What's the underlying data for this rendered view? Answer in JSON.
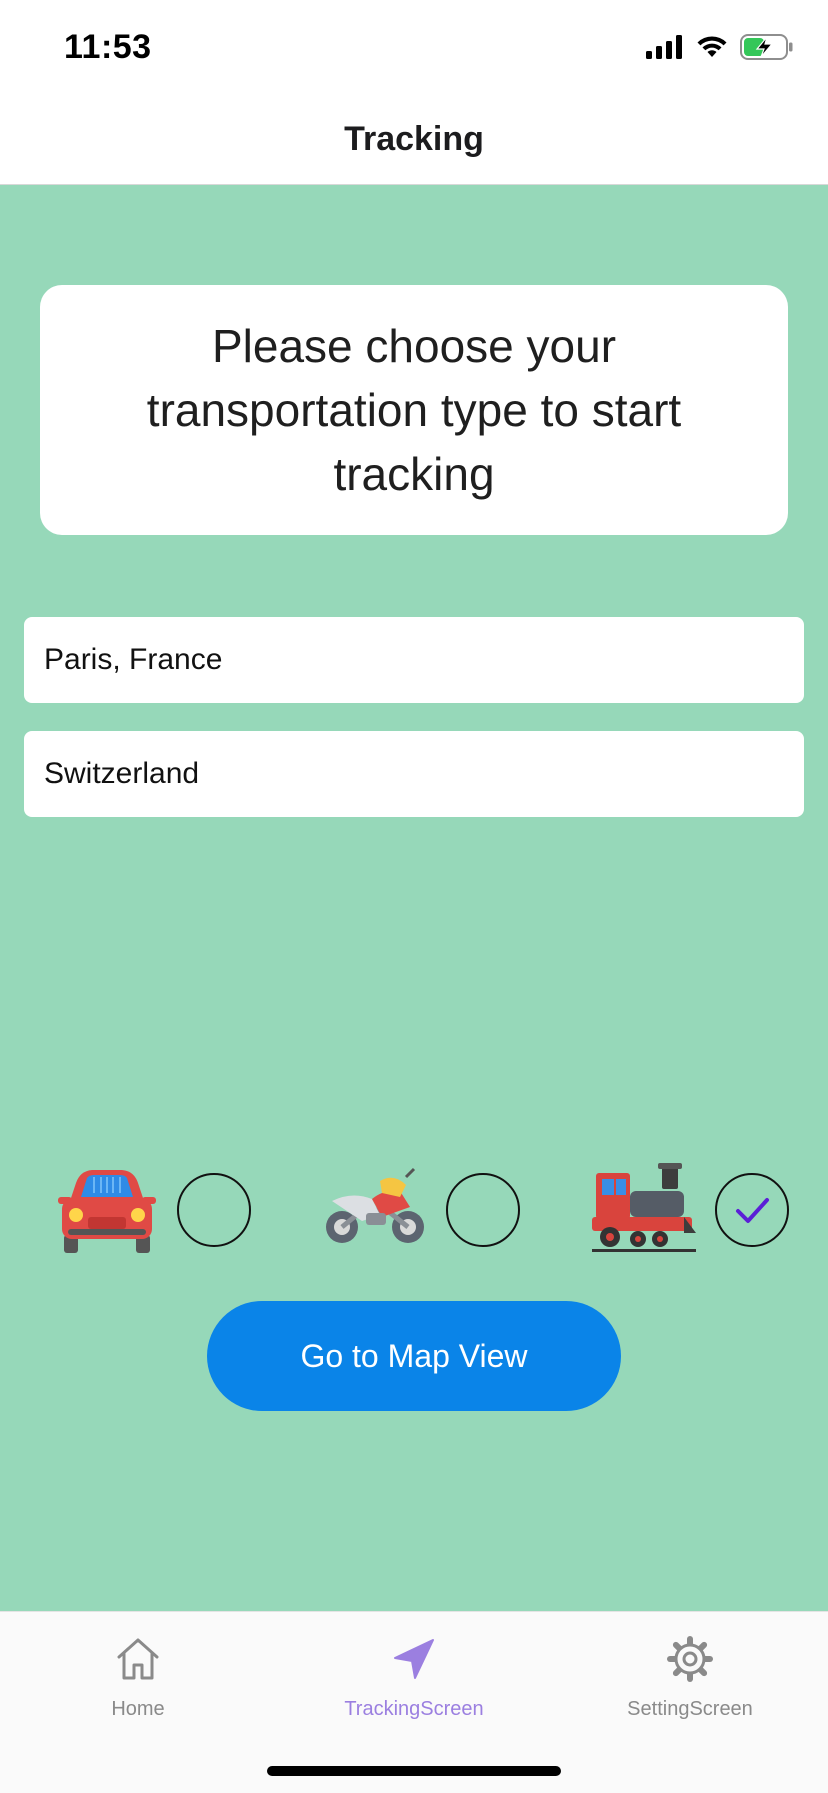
{
  "status_bar": {
    "time": "11:53"
  },
  "header": {
    "title": "Tracking"
  },
  "prompt": {
    "text": "Please choose your transportation type to start tracking"
  },
  "inputs": {
    "origin": {
      "value": "Paris, France"
    },
    "destination": {
      "value": "Switzerland"
    }
  },
  "transport": {
    "options": [
      {
        "icon": "car-icon",
        "selected": false
      },
      {
        "icon": "motorcycle-icon",
        "selected": false
      },
      {
        "icon": "train-icon",
        "selected": true
      }
    ]
  },
  "actions": {
    "go_map_label": "Go to Map View"
  },
  "tabbar": {
    "home": "Home",
    "tracking": "TrackingScreen",
    "settings": "SettingScreen"
  },
  "colors": {
    "background": "#96d8b9",
    "primary_button": "#0a84e8",
    "active_tab": "#9b7fe0",
    "checkmark": "#5b1fd6"
  }
}
